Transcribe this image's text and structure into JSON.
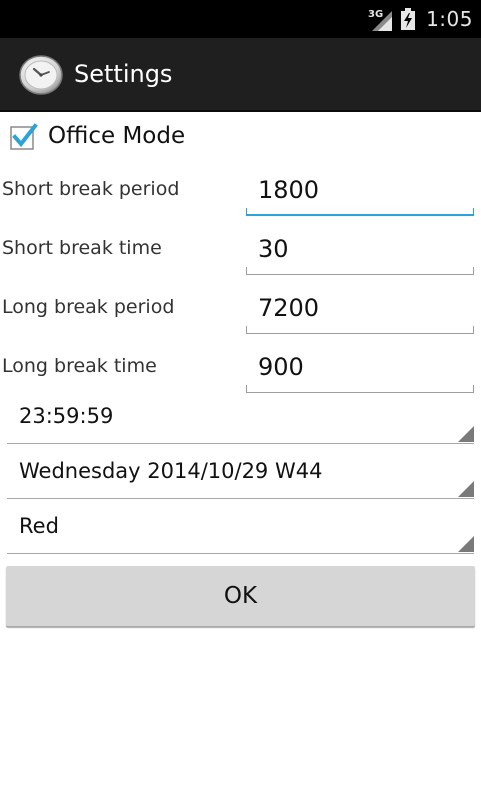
{
  "status_bar": {
    "network": "3G",
    "time": "1:05"
  },
  "action_bar": {
    "title": "Settings",
    "icon": "clock-icon"
  },
  "office_mode": {
    "label": "Office Mode",
    "checked": true
  },
  "fields": [
    {
      "label": "Short break period",
      "value": "1800"
    },
    {
      "label": "Short break time",
      "value": "30"
    },
    {
      "label": "Long break period",
      "value": "7200"
    },
    {
      "label": "Long break time",
      "value": "900"
    }
  ],
  "spinners": [
    {
      "value": "23:59:59"
    },
    {
      "value": "Wednesday 2014/10/29 W44"
    },
    {
      "value": "Red"
    }
  ],
  "ok_button": {
    "label": "OK"
  },
  "colors": {
    "accent": "#2aa3d8",
    "action_bar": "#1f1f1f",
    "status_bar": "#000000",
    "button": "#d6d6d6"
  }
}
